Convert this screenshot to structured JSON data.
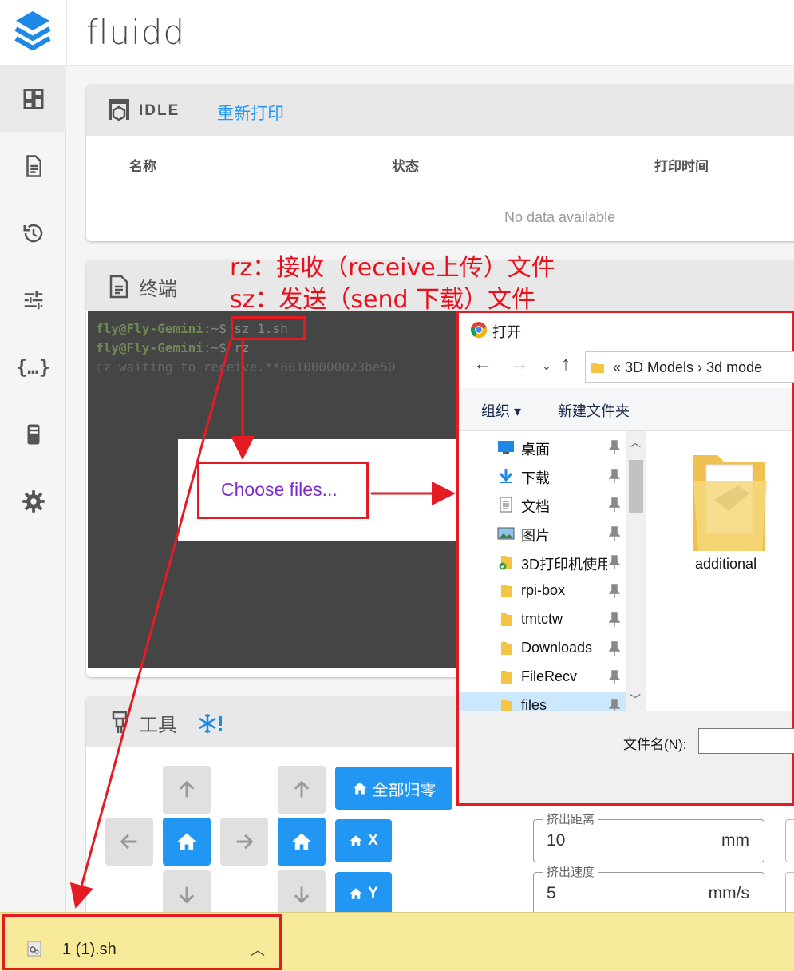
{
  "app": {
    "title": "fluidd"
  },
  "sidebar": {
    "items": [
      {
        "icon": "dashboard-icon"
      },
      {
        "icon": "file-document-icon"
      },
      {
        "icon": "history-icon"
      },
      {
        "icon": "tune-icon"
      },
      {
        "icon": "braces-icon",
        "glyph": "{…}"
      },
      {
        "icon": "printer-device-icon"
      },
      {
        "icon": "settings-cog-icon"
      }
    ]
  },
  "status_card": {
    "state": "IDLE",
    "reprint_label": "重新打印",
    "columns": [
      "名称",
      "状态",
      "打印时间"
    ],
    "empty_text": "No data available"
  },
  "terminal": {
    "title": "终端",
    "prompt_user": "fly@Fly-Gemini",
    "prompt_suffix": ":~$ ",
    "lines": [
      {
        "user": "fly@Fly-Gemini",
        "rest": ":~$ sz 1.sh"
      },
      {
        "user": "fly@Fly-Gemini",
        "rest": ":~$ rz"
      },
      {
        "user": "",
        "rest": "▯z waiting to receive.**B0100000023be50"
      }
    ],
    "choose_files_label": "Choose files..."
  },
  "tools": {
    "title": "工具",
    "home_all_label": "全部归零",
    "home_x_label": "X",
    "home_y_label": "Y",
    "extrude_distance": {
      "label": "挤出距离",
      "value": "10",
      "unit": "mm"
    },
    "extrude_speed": {
      "label": "挤出速度",
      "value": "5",
      "unit": "mm/s"
    }
  },
  "annotations": {
    "rz_note": "rz：接收（receive上传）文件",
    "sz_note": "sz：发送（send 下载）文件"
  },
  "file_dialog": {
    "title": "打开",
    "breadcrumb": "«  3D Models  ›  3d mode",
    "organize_label": "组织 ▾",
    "new_folder_label": "新建文件夹",
    "tree": [
      {
        "label": "桌面",
        "icon": "desktop-icon"
      },
      {
        "label": "下载",
        "icon": "download-arrow-icon"
      },
      {
        "label": "文档",
        "icon": "documents-icon"
      },
      {
        "label": "图片",
        "icon": "pictures-icon"
      },
      {
        "label": "3D打印机使用",
        "icon": "folder-synced-icon"
      },
      {
        "label": "rpi-box",
        "icon": "folder-icon"
      },
      {
        "label": "tmtctw",
        "icon": "folder-icon"
      },
      {
        "label": "Downloads",
        "icon": "folder-icon"
      },
      {
        "label": "FileRecv",
        "icon": "folder-icon"
      },
      {
        "label": "files",
        "icon": "folder-icon"
      }
    ],
    "file_item": "additional",
    "filename_label": "文件名(N):"
  },
  "download_bar": {
    "filename": "1 (1).sh"
  },
  "colors": {
    "accent": "#2196f3",
    "annotation_red": "#e51b24",
    "download_bar": "#f7ea9a"
  }
}
